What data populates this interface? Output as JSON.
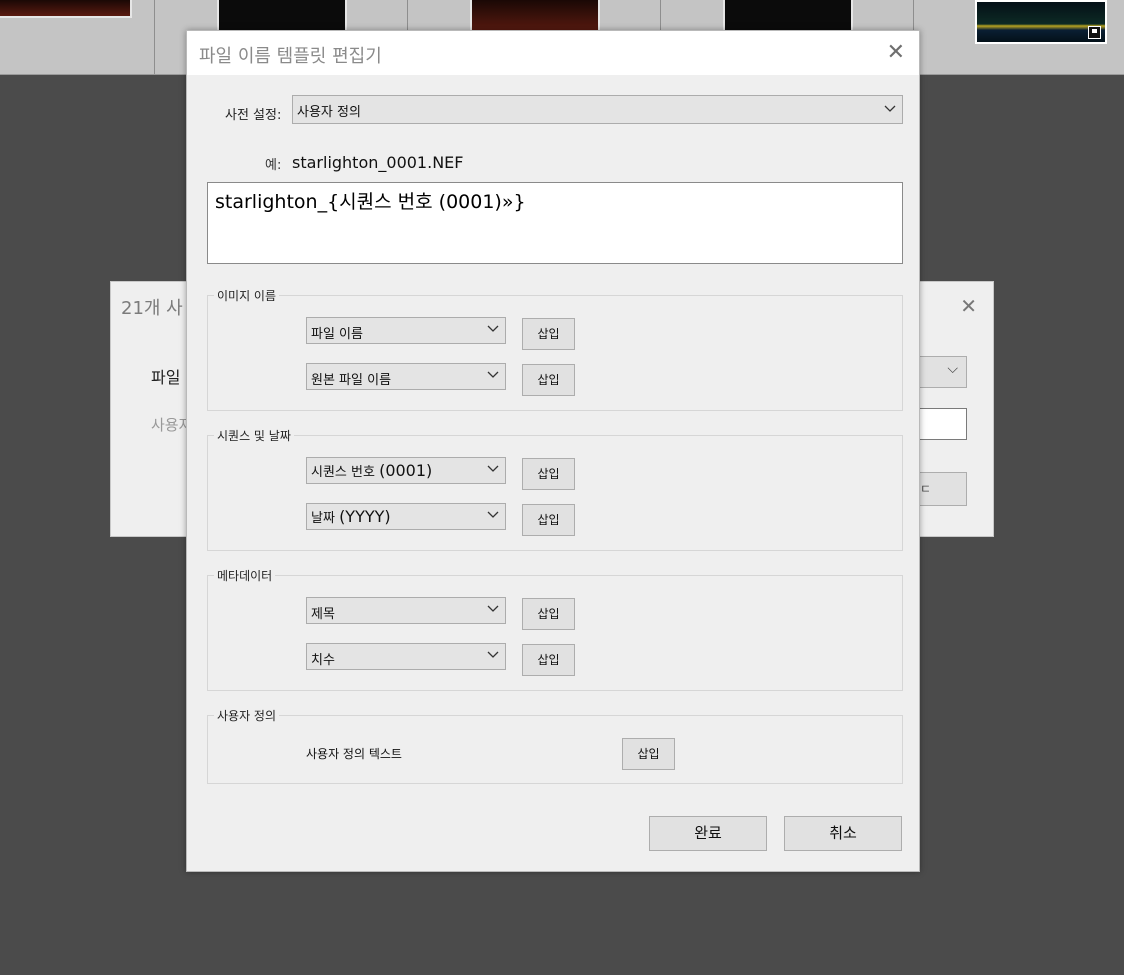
{
  "background_dialog": {
    "title": "21개 사",
    "label_file": "파일",
    "label_custom": "사용자",
    "button_partial": "ㄷ"
  },
  "dialog": {
    "title": "파일 이름 템플릿 편집기",
    "preset_label": "사전 설정:",
    "preset_value": "사용자 정의",
    "example_label": "예:",
    "example_value": "starlighton_0001.NEF",
    "template_prefix": "starlighton_",
    "template_token": "{시퀀스 번호 (0001)»}",
    "insert_label": "삽입",
    "groups": {
      "image_name": {
        "legend": "이미지 이름",
        "option1": "파일 이름",
        "option2": "원본 파일 이름"
      },
      "sequence_date": {
        "legend": "시퀀스 및 날짜",
        "option1_kr": "시퀀스 번호",
        "option1_num": "(0001)",
        "option2_kr": "날짜",
        "option2_num": "(YYYY)"
      },
      "metadata": {
        "legend": "메타데이터",
        "option1": "제목",
        "option2": "치수"
      },
      "custom": {
        "legend": "사용자 정의",
        "text_label": "사용자 정의 텍스트"
      }
    },
    "done_button": "완료",
    "cancel_button": "취소"
  },
  "colors": {
    "workspace": "#4b4b4b",
    "dialog_bg": "#efefef",
    "filmstrip": "#c4c4c4"
  }
}
